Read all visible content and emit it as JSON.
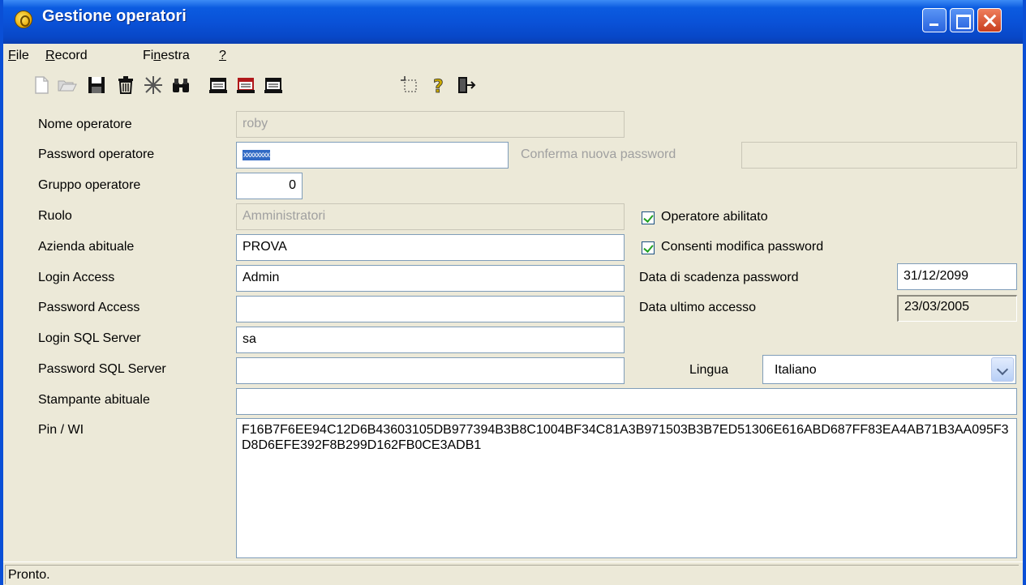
{
  "window": {
    "title": "Gestione operatori"
  },
  "menu": [
    {
      "label": "File",
      "underline": "F",
      "rest": "ile"
    },
    {
      "label": "Record",
      "underline": "R",
      "rest": "ecord"
    },
    {
      "pre": "Fi",
      "underline": "n",
      "rest": "estra",
      "label": "Finestra"
    },
    {
      "label": "?",
      "underline": "?",
      "rest": ""
    }
  ],
  "toolbar": {
    "icons": [
      "new-document-icon",
      "open-folder-icon",
      "save-icon",
      "delete-icon",
      "clear-icon",
      "binoculars-icon",
      "first-record-icon",
      "prev-record-icon",
      "next-record-icon",
      "selection-icon",
      "help-icon",
      "exit-icon"
    ]
  },
  "form": {
    "nome_operatore": {
      "label": "Nome operatore",
      "value": "roby"
    },
    "password_operatore": {
      "label": "Password operatore",
      "value": "xxxxxxxx"
    },
    "conferma_password": {
      "label": "Conferma nuova password",
      "value": ""
    },
    "gruppo_operatore": {
      "label": "Gruppo operatore",
      "value": "0"
    },
    "ruolo": {
      "label": "Ruolo",
      "value": "Amministratori"
    },
    "azienda_abituale": {
      "label": "Azienda abituale",
      "value": "PROVA"
    },
    "login_access": {
      "label": "Login Access",
      "value": "Admin"
    },
    "password_access": {
      "label": "Password Access",
      "value": ""
    },
    "login_sql": {
      "label": "Login SQL Server",
      "value": "sa"
    },
    "password_sql": {
      "label": "Password SQL Server",
      "value": ""
    },
    "stampante_abituale": {
      "label": "Stampante abituale",
      "value": ""
    },
    "pin_wi": {
      "label": "Pin / WI",
      "value": "F16B7F6EE94C12D6B43603105DB977394B3B8C1004BF34C81A3B971503B3B7ED51306E616ABD687FF83EA4AB71B3AA095F3D8D6EFE392F8B299D162FB0CE3ADB1"
    },
    "operatore_abilitato": {
      "label": "Operatore abilitato",
      "checked": true
    },
    "consenti_modifica": {
      "label": "Consenti modifica password",
      "checked": true
    },
    "data_scadenza": {
      "label": "Data di scadenza password",
      "value": "31/12/2099"
    },
    "data_ultimo_accesso": {
      "label": "Data ultimo accesso",
      "value": "23/03/2005"
    },
    "lingua": {
      "label": "Lingua",
      "value": "Italiano"
    }
  },
  "status": {
    "text": "Pronto."
  },
  "colors": {
    "titlebar": "#0a52d8",
    "window_bg": "#ece9d8",
    "selection": "#316ac5"
  }
}
